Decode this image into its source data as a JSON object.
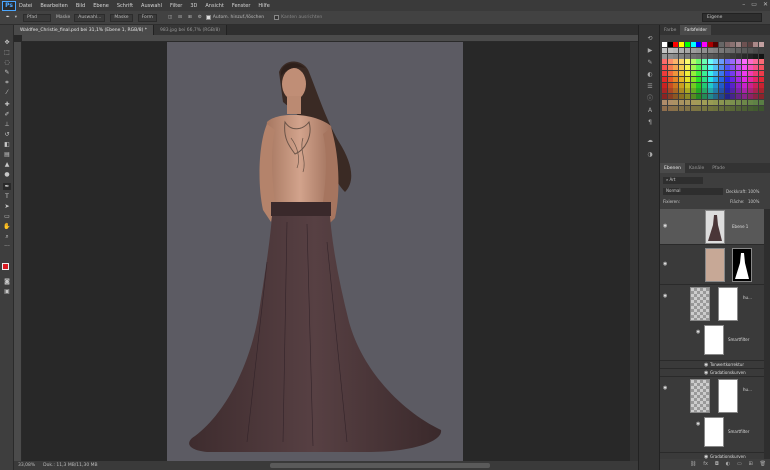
{
  "app": {
    "logo": "Ps"
  },
  "menu": [
    "Datei",
    "Bearbeiten",
    "Bild",
    "Ebene",
    "Schrift",
    "Auswahl",
    "Filter",
    "3D",
    "Ansicht",
    "Fenster",
    "Hilfe"
  ],
  "window_controls": [
    "–",
    "▭",
    "✕"
  ],
  "options": {
    "mode_select": "Pfad",
    "btn_maske": "Maske",
    "btn_auswahl": "Auswahl...",
    "btn_fuellen": "Maske",
    "btn_form": "Form",
    "auto_label": "Autom. hinzuf./löschen",
    "align_label": "Kanten ausrichten"
  },
  "workspace": "Eigene",
  "doc_tabs": [
    {
      "label": "Waldfee_Christie_final.psd bei 31,1% (Ebene 1, RGB/8) *",
      "active": true
    },
    {
      "label": "983.jpg bei 66,7% (RGB/8)",
      "active": false
    }
  ],
  "status": {
    "zoom": "33,08%",
    "doc": "Dok.: 11,3 MB/11,30 MB"
  },
  "panels": {
    "color_tabs": [
      "Farbe",
      "Farbfelder"
    ],
    "layer_tabs": [
      "Ebenen",
      "Kanäle",
      "Pfade"
    ],
    "kind_filter": "Art",
    "blend_mode": "Normal",
    "opacity_label": "Deckkraft:",
    "opacity_value": "100%",
    "lock_label": "Fixieren:",
    "fill_label": "Fläche:",
    "fill_value": "100%"
  },
  "layers": [
    {
      "name": "Ebene 1"
    },
    {
      "name": ""
    },
    {
      "name": "hu..."
    },
    {
      "name": "Smartfilter"
    },
    {
      "name": "Tonwertkorrektur"
    },
    {
      "name": "Gradationskurven"
    },
    {
      "name": "hu..."
    },
    {
      "name": "Smartfilter"
    },
    {
      "name": "Gradationskurven"
    }
  ],
  "colors": {
    "bg": "#282828",
    "panel": "#3e3e3e",
    "artboard": "#5c5b63",
    "dress": "#4a3638",
    "skin": "#c99a84",
    "hair": "#3a2a24",
    "fg_swatch": "#d71920",
    "accent": "#4aa6ff"
  }
}
